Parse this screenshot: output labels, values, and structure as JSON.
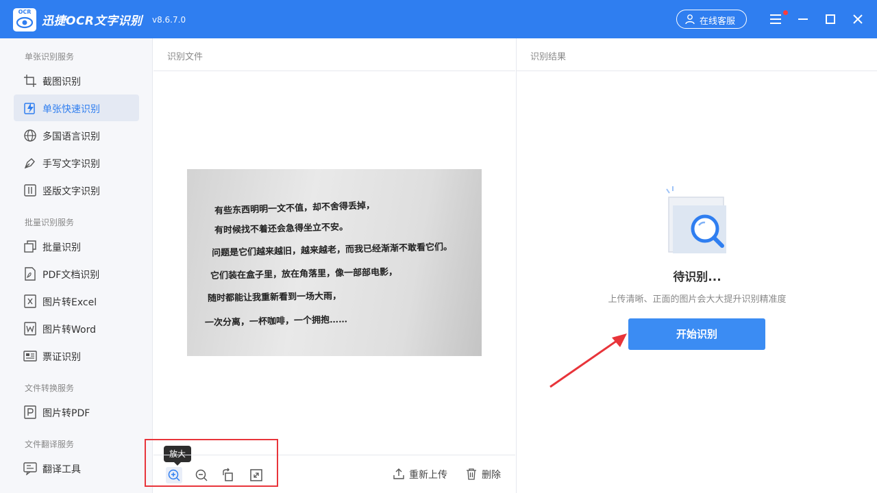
{
  "app": {
    "title": "迅捷OCR文字识别",
    "version": "v8.6.7.0",
    "logo_text": "OCR",
    "online_service_label": "在线客服",
    "brand_color": "#2f7ef0"
  },
  "sidebar": {
    "sections": [
      {
        "title": "单张识别服务",
        "items": [
          {
            "label": "截图识别",
            "icon": "crop-icon"
          },
          {
            "label": "单张快速识别",
            "icon": "quick-scan-icon",
            "active": true
          },
          {
            "label": "多国语言识别",
            "icon": "globe-icon"
          },
          {
            "label": "手写文字识别",
            "icon": "pen-icon"
          },
          {
            "label": "竖版文字识别",
            "icon": "vertical-text-icon"
          }
        ]
      },
      {
        "title": "批量识别服务",
        "items": [
          {
            "label": "批量识别",
            "icon": "batch-icon"
          },
          {
            "label": "PDF文档识别",
            "icon": "pdf-icon"
          },
          {
            "label": "图片转Excel",
            "icon": "excel-icon"
          },
          {
            "label": "图片转Word",
            "icon": "word-icon"
          },
          {
            "label": "票证识别",
            "icon": "ticket-icon"
          }
        ]
      },
      {
        "title": "文件转换服务",
        "items": [
          {
            "label": "图片转PDF",
            "icon": "image-to-pdf-icon"
          }
        ]
      },
      {
        "title": "文件翻译服务",
        "items": [
          {
            "label": "翻译工具",
            "icon": "translate-icon"
          }
        ]
      }
    ]
  },
  "center": {
    "header": "识别文件",
    "photo_lines": [
      "有些东西明明一文不值，却不舍得丢掉，",
      "有时候找不着还会急得坐立不安。",
      "问题是它们越来越旧，越来越老，而我已经渐渐不敢看它们。",
      "它们装在盒子里，放在角落里，像一部部电影，",
      "随时都能让我重新看到一场大雨，",
      "一次分离，一杯咖啡，一个拥抱……"
    ],
    "toolbar": {
      "tooltip": "放大",
      "reupload_label": "重新上传",
      "delete_label": "删除"
    }
  },
  "right": {
    "header": "识别结果",
    "status_title": "待识别...",
    "hint": "上传清晰、正面的图片会大大提升识别精准度",
    "start_button": "开始识别"
  }
}
